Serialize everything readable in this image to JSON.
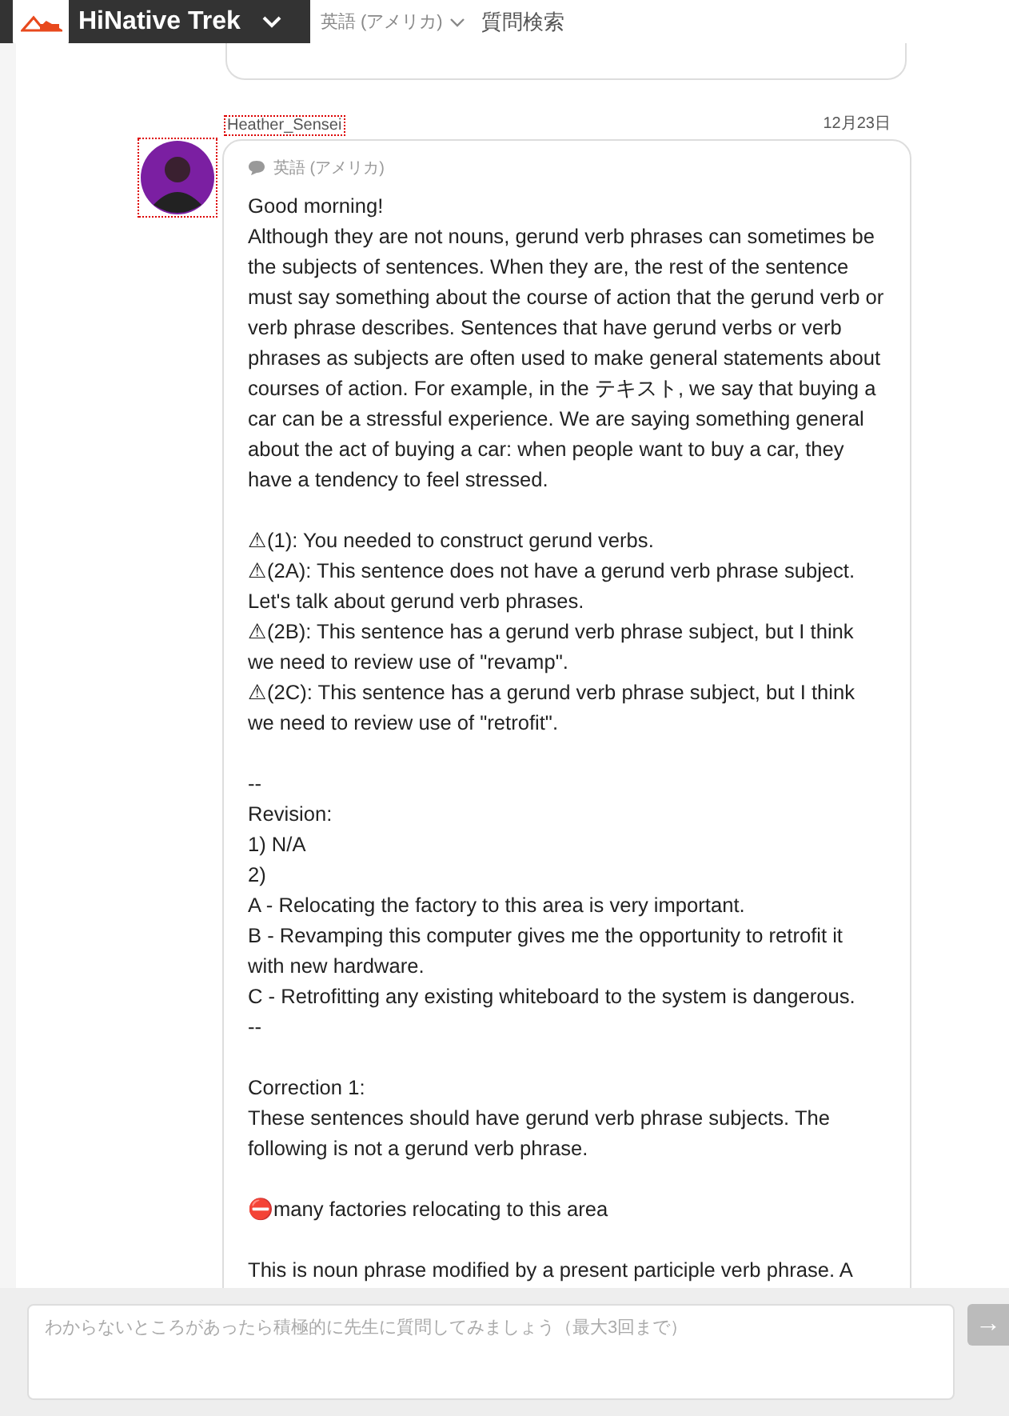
{
  "header": {
    "title": "HiNative Trek",
    "language": "英語 (アメリカ)",
    "search": "質問検索"
  },
  "message": {
    "author": "Heather_Sensei",
    "date": "12月23日",
    "language": "英語 (アメリカ)",
    "paragraphs": [
      [
        "Good morning!",
        "Although they are not nouns, gerund verb phrases can sometimes be the subjects of sentences. When they are, the rest of the sentence must say something about the course of action that the gerund verb or verb phrase describes. Sentences that have gerund verbs or verb phrases as subjects are often used to make general statements about courses of action. For example, in the テキスト, we say that buying a car can be a stressful experience. We are saying something general about the act of buying a car: when people want to buy a car, they have a tendency to feel stressed."
      ],
      [
        "⚠(1): You needed to construct gerund verbs.",
        "⚠(2A): This sentence does not have a gerund verb phrase subject. Let's talk about gerund verb phrases.",
        "⚠(2B): This sentence has a gerund verb phrase subject, but I think we need to review use of \"revamp\".",
        "⚠(2C): This sentence has a gerund verb phrase subject, but I think we need to review use of \"retrofit\"."
      ],
      [
        "--",
        "Revision:",
        "1) N/A",
        "2)",
        "A - Relocating the factory to this area is very important.",
        "B - Revamping this computer gives me the opportunity to retrofit it with new hardware.",
        "C - Retrofitting any existing whiteboard to the system is dangerous.",
        "--"
      ],
      [
        "Correction 1:",
        "These sentences should have gerund verb phrase subjects. The following is not a gerund verb phrase."
      ],
      [
        "⛔many factories relocating to this area"
      ],
      [
        "This is noun phrase modified by a present participle verb phrase. A"
      ]
    ]
  },
  "composer": {
    "placeholder": "わからないところがあったら積極的に先生に質問してみましょう（最大3回まで）",
    "send": "→"
  }
}
